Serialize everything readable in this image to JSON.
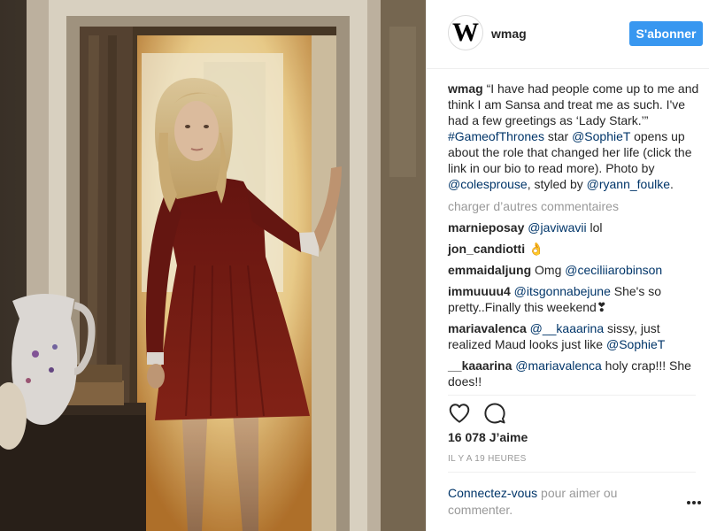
{
  "header": {
    "avatar_letter": "W",
    "username": "wmag",
    "follow_label": "S'abonner"
  },
  "caption": {
    "user": "wmag",
    "text1": "“I have had people come up to me and think I am Sansa and treat me as such. I've had a few greetings as ‘Lady Stark.’” ",
    "hashtag": "#GameofThrones",
    "text2": " star ",
    "mention1": "@SophieT",
    "text3": " opens up about the role that changed her life (click the link in our bio to read more). Photo by ",
    "mention2": "@colesprouse",
    "text4": ", styled by ",
    "mention3": "@ryann_foulke",
    "text5": "."
  },
  "load_more": "charger d’autres commentaires",
  "comments": [
    {
      "user": "marnieposay",
      "mention": "@javiwavii",
      "text": " lol"
    },
    {
      "user": "jon_candiotti",
      "emoji": "👌"
    },
    {
      "user": "emmaidaljung",
      "text": "Omg ",
      "mention": "@ceciliiarobinson"
    },
    {
      "user": "immuuuu4",
      "mention": "@itsgonnabejune",
      "text": " She's so pretty..Finally this weekend❣"
    },
    {
      "user": "mariavalenca",
      "mention": "@__kaaarina",
      "text": " sissy, just realized Maud looks just like ",
      "mention2": "@SophieT"
    },
    {
      "user": "__kaaarina",
      "mention": "@mariavalenca",
      "text": " holy crap!!! She does!!"
    }
  ],
  "likes": "16 078 J’aime",
  "timestamp": "IL Y A 19 HEURES",
  "login": {
    "link": "Connectez-vous",
    "text": " pour aimer ou commenter."
  },
  "icons": {
    "like": "heart-outline-icon",
    "comment": "speech-bubble-icon",
    "more": "ellipsis-icon"
  },
  "colors": {
    "accent": "#3897f0",
    "link": "#003569",
    "muted": "#999999",
    "dress": "#7a1a15"
  }
}
